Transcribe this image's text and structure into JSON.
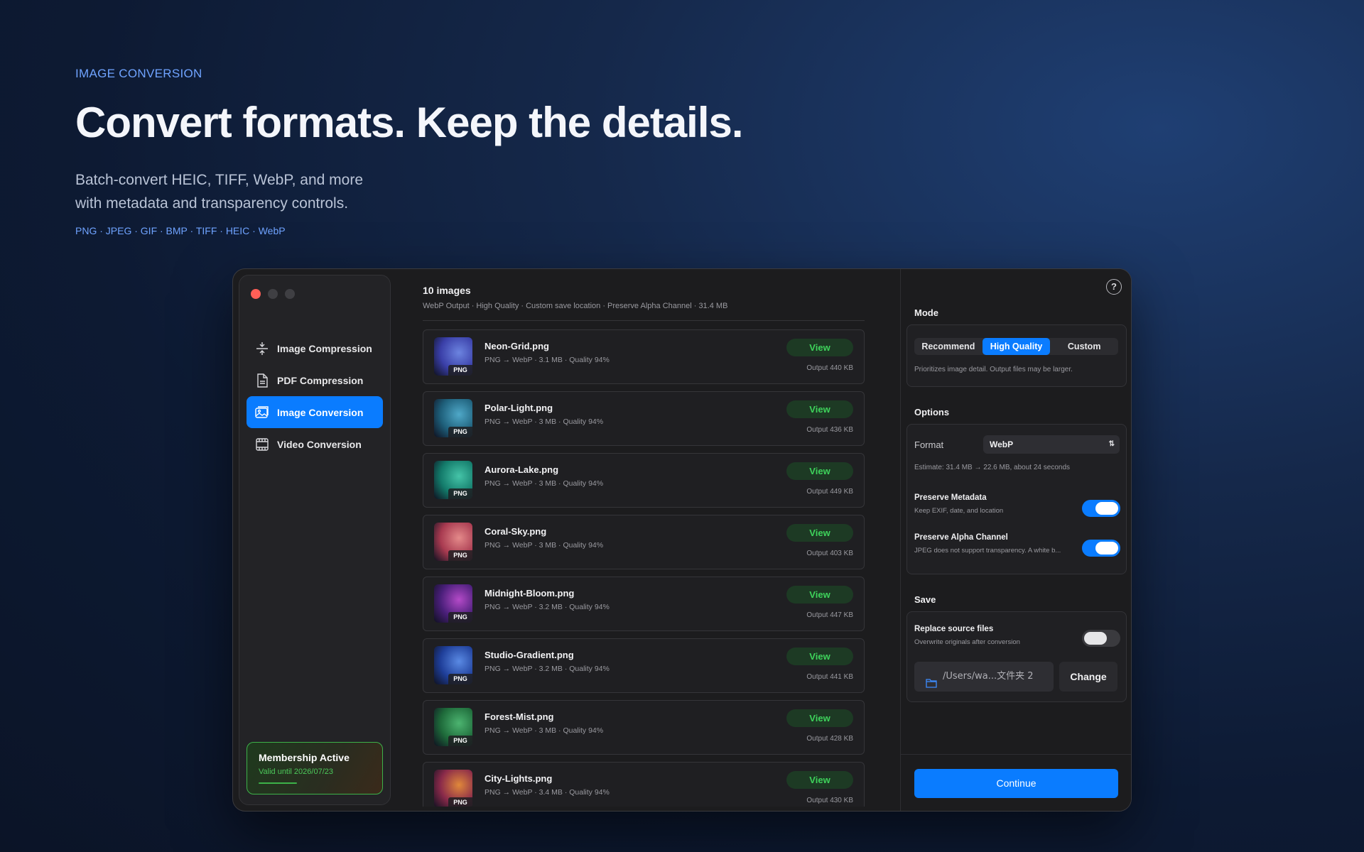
{
  "hero": {
    "eyebrow": "IMAGE CONVERSION",
    "headline": "Convert formats. Keep the details.",
    "subline_1": "Batch-convert HEIC, TIFF, WebP, and more",
    "subline_2": "with metadata and transparency controls.",
    "formats": "PNG · JPEG · GIF · BMP · TIFF · HEIC · WebP"
  },
  "sidebar": {
    "items": [
      {
        "label": "Image Compression",
        "icon": "compress-icon",
        "active": false
      },
      {
        "label": "PDF Compression",
        "icon": "document-icon",
        "active": false
      },
      {
        "label": "Image Conversion",
        "icon": "image-icon",
        "active": true
      },
      {
        "label": "Video Conversion",
        "icon": "film-icon",
        "active": false
      }
    ],
    "membership": {
      "title": "Membership Active",
      "valid": "Valid until 2026/07/23"
    }
  },
  "main": {
    "count": "10 images",
    "summary": "WebP Output · High Quality · Custom save location · Preserve Alpha Channel · 31.4 MB",
    "view_label": "View",
    "badge": "PNG",
    "items": [
      {
        "name": "Neon-Grid.png",
        "meta": "PNG → WebP · 3.1 MB · Quality 94%",
        "output": "Output 440 KB",
        "colors": [
          "#3a3fa8",
          "#6c84e0"
        ]
      },
      {
        "name": "Polar-Light.png",
        "meta": "PNG → WebP · 3 MB · Quality 94%",
        "output": "Output 436 KB",
        "colors": [
          "#1e5f7a",
          "#4fa8c8"
        ]
      },
      {
        "name": "Aurora-Lake.png",
        "meta": "PNG → WebP · 3 MB · Quality 94%",
        "output": "Output 449 KB",
        "colors": [
          "#137a6a",
          "#45c4a8"
        ]
      },
      {
        "name": "Coral-Sky.png",
        "meta": "PNG → WebP · 3 MB · Quality 94%",
        "output": "Output 403 KB",
        "colors": [
          "#a83a50",
          "#e48a8a"
        ]
      },
      {
        "name": "Midnight-Bloom.png",
        "meta": "PNG → WebP · 3.2 MB · Quality 94%",
        "output": "Output 447 KB",
        "colors": [
          "#4a1f7a",
          "#b44ac8"
        ]
      },
      {
        "name": "Studio-Gradient.png",
        "meta": "PNG → WebP · 3.2 MB · Quality 94%",
        "output": "Output 441 KB",
        "colors": [
          "#1f3f9a",
          "#5a8ae4"
        ]
      },
      {
        "name": "Forest-Mist.png",
        "meta": "PNG → WebP · 3 MB · Quality 94%",
        "output": "Output 428 KB",
        "colors": [
          "#1e6a3a",
          "#4cb470"
        ]
      },
      {
        "name": "City-Lights.png",
        "meta": "PNG → WebP · 3.4 MB · Quality 94%",
        "output": "Output 430 KB",
        "colors": [
          "#8a2a4a",
          "#e0883a"
        ]
      }
    ]
  },
  "panel": {
    "mode_title": "Mode",
    "modes": [
      "Recommend",
      "High Quality",
      "Custom"
    ],
    "mode_active": 1,
    "mode_note": "Prioritizes image detail. Output files may be larger.",
    "options_title": "Options",
    "format_label": "Format",
    "format_value": "WebP",
    "estimate": "Estimate: 31.4 MB → 22.6 MB, about 24 seconds",
    "meta_title": "Preserve Metadata",
    "meta_sub": "Keep EXIF, date, and location",
    "meta_on": true,
    "alpha_title": "Preserve Alpha Channel",
    "alpha_sub": "JPEG does not support transparency. A white b...",
    "alpha_on": true,
    "save_title": "Save",
    "replace_title": "Replace source files",
    "replace_sub": "Overwrite originals after conversion",
    "replace_on": false,
    "path": "/Users/wa...文件夹 2",
    "change": "Change",
    "continue": "Continue",
    "help": "?"
  },
  "colors": {
    "accent": "#0a7cff",
    "success": "#3ed35b",
    "close": "#ff5f57"
  }
}
